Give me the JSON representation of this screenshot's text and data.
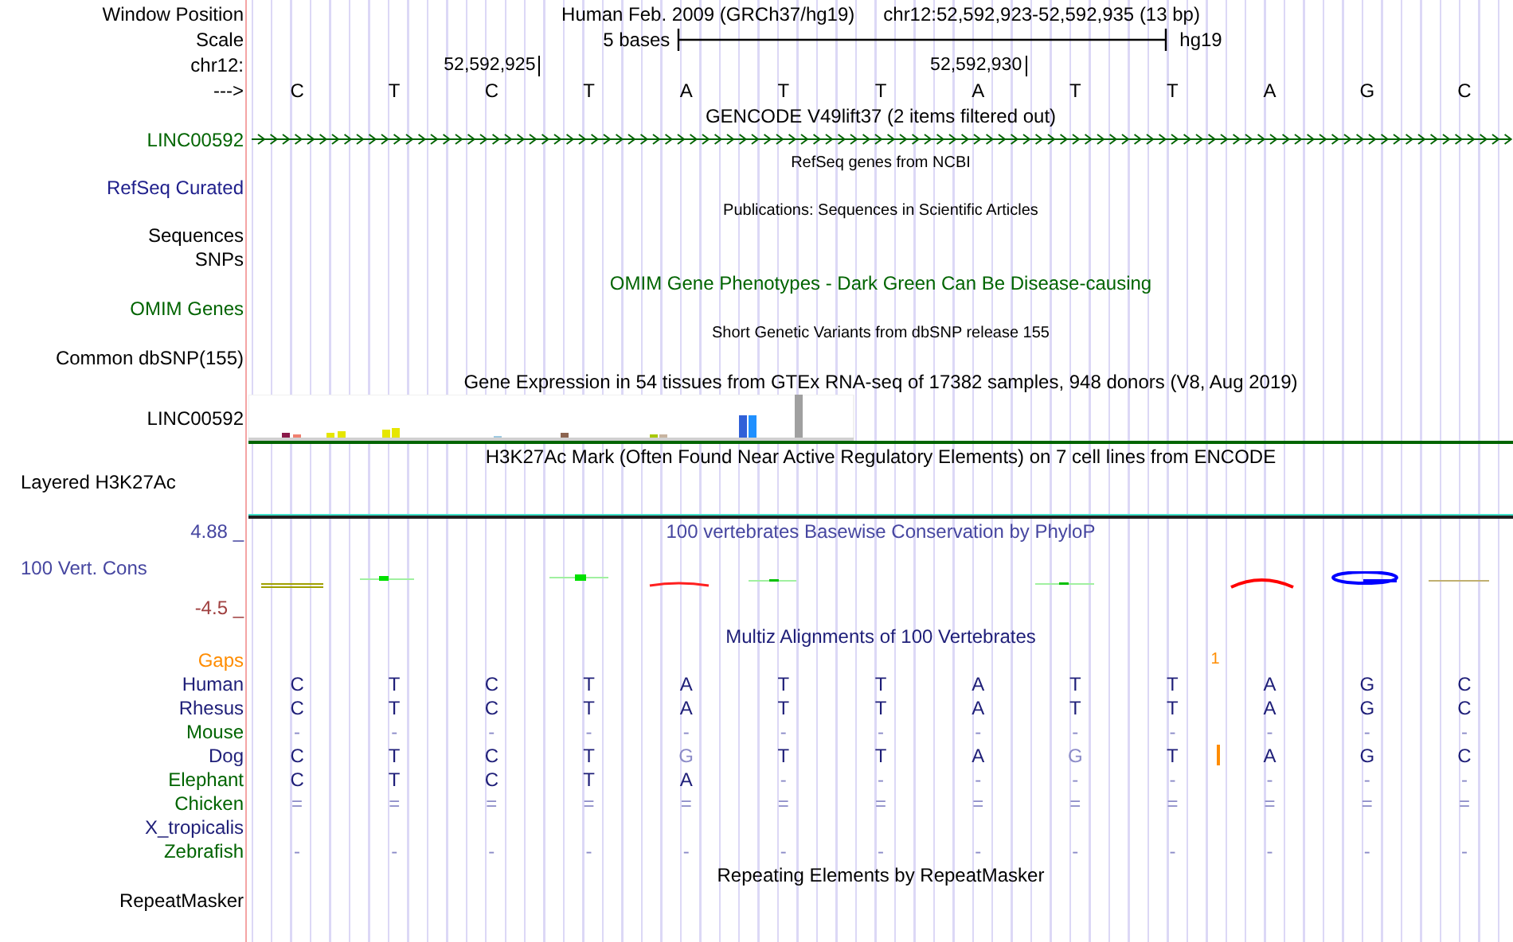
{
  "header": {
    "label": "Window Position",
    "assembly_title": "Human Feb. 2009 (GRCh37/hg19)",
    "position": "chr12:52,592,923-52,592,935 (13 bp)"
  },
  "scale": {
    "label": "Scale",
    "text": "5 bases",
    "assembly": "hg19"
  },
  "ruler": {
    "label": "chr12:",
    "ticks": [
      "52,592,925",
      "52,592,930"
    ]
  },
  "sequence": {
    "label": "--->",
    "bases": [
      "C",
      "T",
      "C",
      "T",
      "A",
      "T",
      "T",
      "A",
      "T",
      "T",
      "A",
      "G",
      "C"
    ]
  },
  "tracks": [
    {
      "kind": "gene",
      "title": "GENCODE V49lift37 (2 items filtered out)",
      "color": "#000000",
      "labels": [
        {
          "text": "LINC00592",
          "color": "#006400"
        }
      ]
    },
    {
      "kind": "dense",
      "title": "RefSeq genes from NCBI",
      "color": "#000000",
      "labels": [
        {
          "text": "RefSeq Curated",
          "color": "#20208c"
        }
      ]
    },
    {
      "kind": "dense",
      "title": "Publications: Sequences in Scientific Articles",
      "color": "#000000",
      "labels": [
        {
          "text": "Sequences",
          "color": "#000000"
        },
        {
          "text": "SNPs",
          "color": "#000000"
        }
      ]
    },
    {
      "kind": "full",
      "title": "OMIM Gene Phenotypes - Dark Green Can Be Disease-causing",
      "color": "#006400",
      "labels": [
        {
          "text": "OMIM Genes",
          "color": "#006400"
        }
      ]
    },
    {
      "kind": "dense",
      "title": "Short Genetic Variants from dbSNP release 155",
      "color": "#000000",
      "labels": [
        {
          "text": "Common dbSNP(155)",
          "color": "#000000"
        }
      ]
    },
    {
      "kind": "expression",
      "title": "Gene Expression in 54 tissues from GTEx RNA-seq of 17382 samples, 948 donors (V8, Aug 2019)",
      "color": "#000000",
      "labels": [
        {
          "text": "LINC00592",
          "color": "#000000"
        }
      ]
    },
    {
      "kind": "layered",
      "title": "H3K27Ac Mark (Often Found Near Active Regulatory Elements) on 7 cell lines from ENCODE",
      "color": "#000000",
      "labels": [
        {
          "text": "Layered H3K27Ac",
          "color": "#000000"
        }
      ]
    },
    {
      "kind": "conservation",
      "title": "100 vertebrates Basewise Conservation by PhyloP",
      "color": "#4646a0",
      "max_label": "4.88 _",
      "min_label": "-4.5 _",
      "labels": [
        {
          "text": "100 Vert. Cons",
          "color": "#4646a0"
        }
      ]
    },
    {
      "kind": "multiz",
      "title": "Multiz Alignments of 100 Vertebrates",
      "color": "#1e1e78",
      "gaps": {
        "label": "Gaps",
        "color": "#ff8c00",
        "count": "1"
      },
      "species": [
        {
          "name": "Human",
          "color": "#1e1e78",
          "bases": [
            "C",
            "T",
            "C",
            "T",
            "A",
            "T",
            "T",
            "A",
            "T",
            "T",
            "A",
            "G",
            "C"
          ]
        },
        {
          "name": "Rhesus",
          "color": "#1e1e78",
          "bases": [
            "C",
            "T",
            "C",
            "T",
            "A",
            "T",
            "T",
            "A",
            "T",
            "T",
            "A",
            "G",
            "C"
          ]
        },
        {
          "name": "Mouse",
          "color": "#006400",
          "bases": [
            "-",
            "-",
            "-",
            "-",
            "-",
            "-",
            "-",
            "-",
            "-",
            "-",
            "-",
            "-",
            "-"
          ]
        },
        {
          "name": "Dog",
          "color": "#1e1e78",
          "bases": [
            "C",
            "T",
            "C",
            "T",
            "G",
            "T",
            "T",
            "A",
            "G",
            "T",
            "A",
            "G",
            "C"
          ],
          "insertions": [
            false,
            false,
            false,
            false,
            false,
            false,
            false,
            false,
            false,
            true,
            false,
            false,
            false
          ]
        },
        {
          "name": "Elephant",
          "color": "#006400",
          "bases": [
            "C",
            "T",
            "C",
            "T",
            "A",
            "-",
            "-",
            "-",
            "-",
            "-",
            "-",
            "-",
            "-"
          ]
        },
        {
          "name": "Chicken",
          "color": "#006400",
          "bases": [
            "=",
            "=",
            "=",
            "=",
            "=",
            "=",
            "=",
            "=",
            "=",
            "=",
            "=",
            "=",
            "="
          ]
        },
        {
          "name": "X_tropicalis",
          "color": "#1e1e78"
        },
        {
          "name": "Zebrafish",
          "color": "#006400",
          "bases": [
            "-",
            "-",
            "-",
            "-",
            "-",
            "-",
            "-",
            "-",
            "-",
            "-",
            "-",
            "-",
            "-"
          ]
        }
      ]
    },
    {
      "kind": "full",
      "title": "Repeating Elements by RepeatMasker",
      "color": "#000000",
      "labels": [
        {
          "text": "RepeatMasker",
          "color": "#000000"
        }
      ]
    }
  ]
}
